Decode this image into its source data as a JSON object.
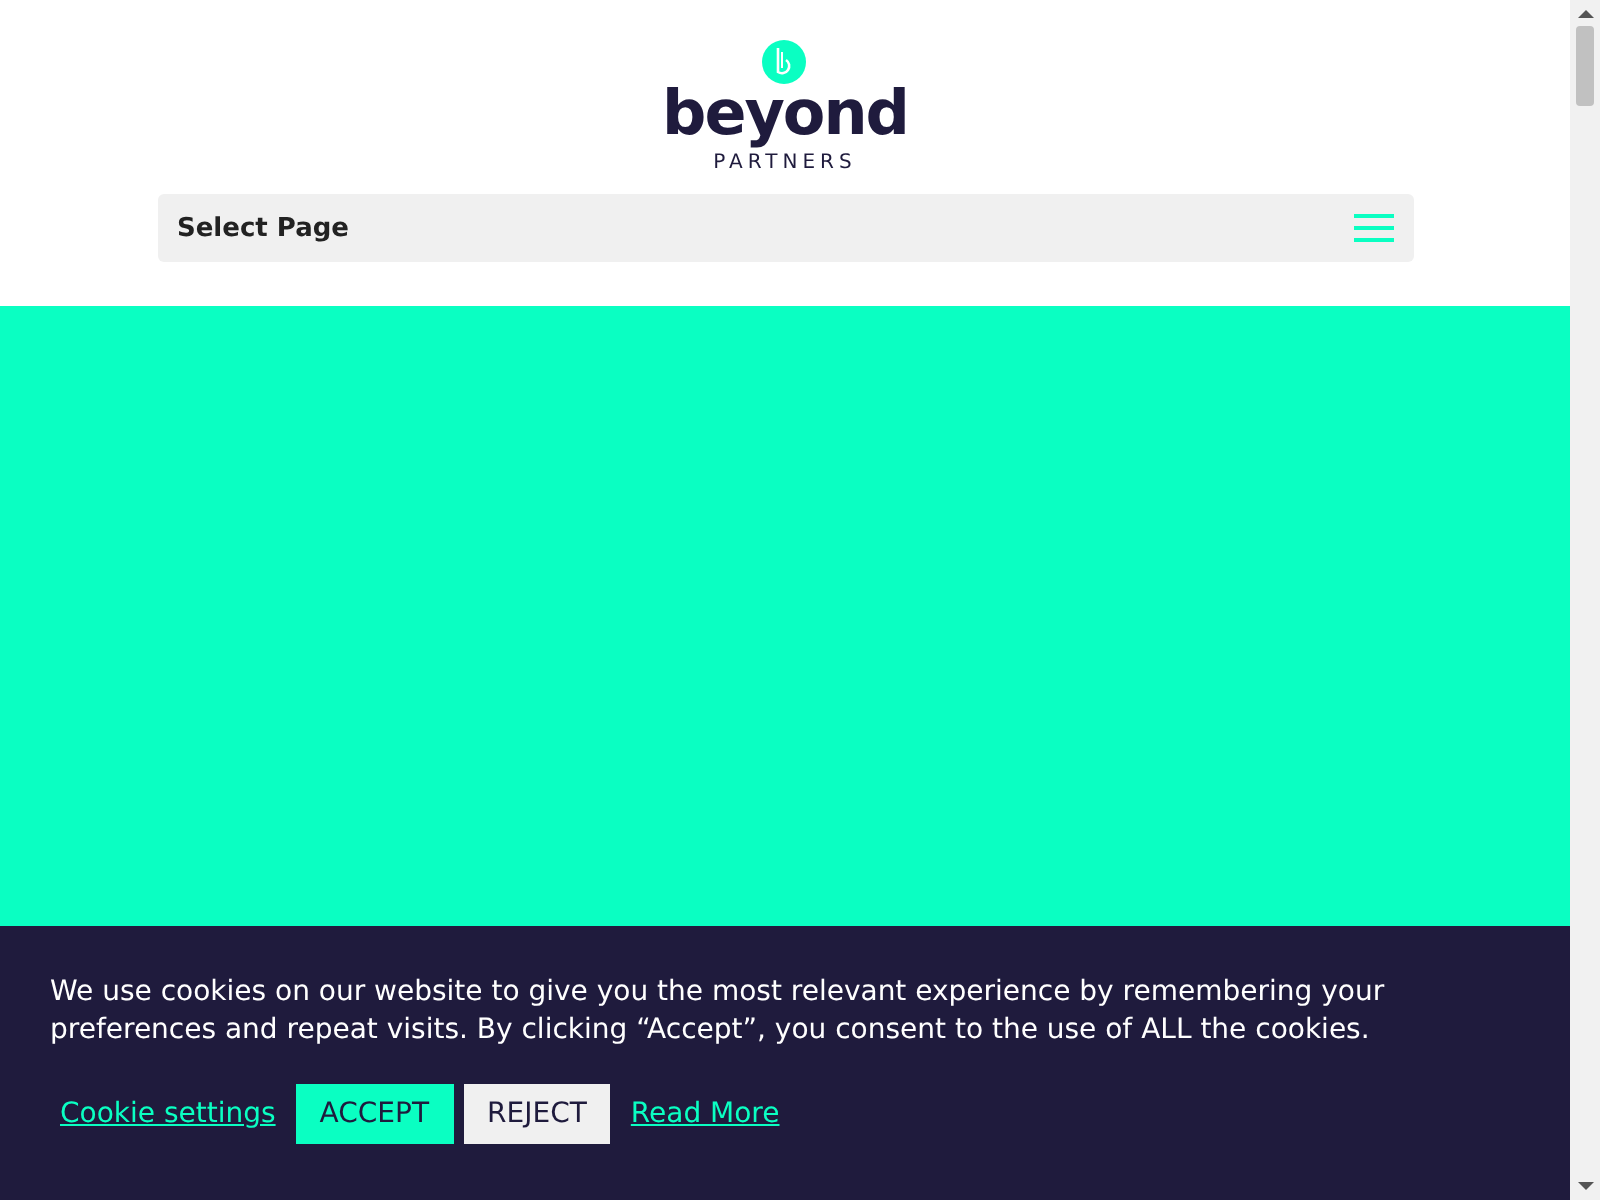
{
  "logo": {
    "name": "beyond",
    "tagline": "PARTNERS"
  },
  "nav": {
    "label": "Select Page"
  },
  "cookie_banner": {
    "message": "We use cookies on our website to give you the most relevant experience by remembering your preferences and repeat visits. By clicking “Accept”, you consent to the use of ALL the cookies.",
    "actions": [
      {
        "kind": "link",
        "label": "Cookie settings"
      },
      {
        "kind": "accept",
        "label": "ACCEPT"
      },
      {
        "kind": "reject",
        "label": "REJECT"
      },
      {
        "kind": "link",
        "label": "Read More"
      }
    ]
  }
}
